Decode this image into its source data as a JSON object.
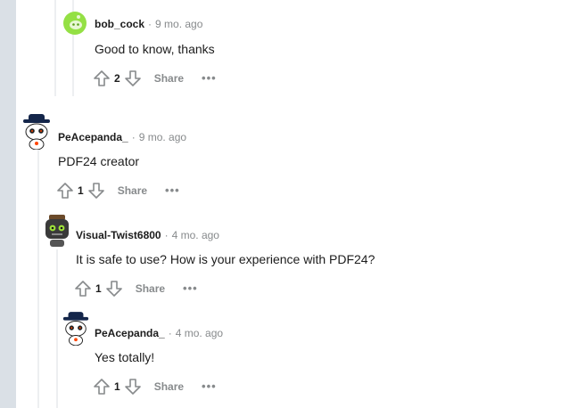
{
  "comments": [
    {
      "author": "bob_cock",
      "time": "9 mo. ago",
      "body": "Good to know, thanks",
      "score": "2",
      "share_label": "Share",
      "more_label": "•••"
    },
    {
      "author": "PeAcepanda_",
      "time": "9 mo. ago",
      "body": "PDF24 creator",
      "score": "1",
      "share_label": "Share",
      "more_label": "•••"
    },
    {
      "author": "Visual-Twist6800",
      "time": "4 mo. ago",
      "body": "It is safe to use? How is your experience with PDF24?",
      "score": "1",
      "share_label": "Share",
      "more_label": "•••"
    },
    {
      "author": "PeAcepanda_",
      "time": "4 mo. ago",
      "body": "Yes totally!",
      "score": "1",
      "share_label": "Share",
      "more_label": "•••"
    }
  ],
  "separator": "·",
  "colors": {
    "background": "#ffffff",
    "side_strip": "#dae0e6",
    "thread_line": "#edeff1",
    "meta_gray": "#878a8c",
    "text": "#1c1c1c",
    "avatar_green": "#94e044"
  },
  "icons": [
    "upvote-arrow-icon",
    "downvote-arrow-icon",
    "snoo-avatar-icon"
  ]
}
